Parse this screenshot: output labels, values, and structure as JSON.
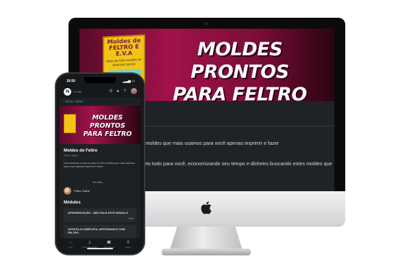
{
  "banner": {
    "title_line1": "MOLDES PRONTOS",
    "title_line2": "PARA FELTRO",
    "product_title": "Moldes de FELTRO E E.V.A",
    "product_subtitle": "Mais de 500 moldes de diversos temas"
  },
  "desktop": {
    "line1": "500 moldes que mais usamos para você apenas imprimir e fazer",
    "line2": "mpleto todo para você, economizando seu tempo e dinheiro buscando estes moldes que"
  },
  "phone": {
    "status_time": "18:50",
    "app_lang": "PT-BR",
    "breadcrumb_home": "Início",
    "breadcrumb_current": "Curso",
    "banner_title_line1": "MOLDES PRONTOS",
    "banner_title_line2": "PARA FELTRO",
    "course_title": "Moldes de Feltro",
    "course_subtitle": "Feltro Online",
    "course_description": "Descobrimos reunir os mais de 500 moldes que mais usamos para você apenas imprimir e fazer",
    "see_more": "Ver mais",
    "author_name": "Feltro Online",
    "modules_heading": "Módulos",
    "modules": [
      {
        "label": "APRESENTAÇÃO - NÃO PULE ESTE MÓDULO",
        "action": "Abrir"
      },
      {
        "label": "APOSTILA COMPLETA: ARTESANATO COM FELTRO",
        "action": "Abrir"
      }
    ],
    "nav": [
      {
        "label": "Início",
        "icon": "home-icon"
      },
      {
        "label": "Meus Downloads",
        "icon": "download-icon"
      },
      {
        "label": "Itens Salvos",
        "icon": "bookmark-icon"
      },
      {
        "label": "Menu",
        "icon": "menu-icon"
      }
    ]
  },
  "colors": {
    "banner_magenta": "#a1124a",
    "dark_bg": "#1f2327",
    "accent_green": "#2ea44f"
  }
}
